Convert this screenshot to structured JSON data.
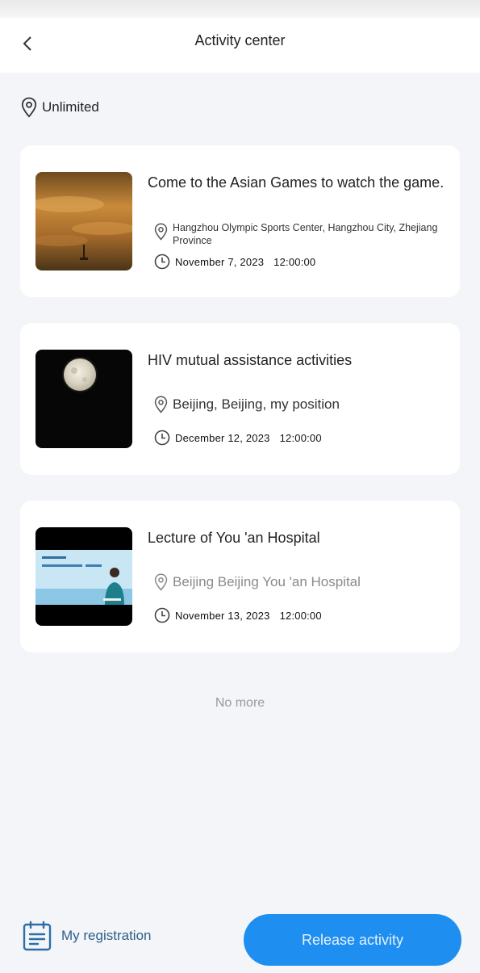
{
  "header": {
    "title": "Activity center"
  },
  "filter": {
    "label": "Unlimited"
  },
  "activities": [
    {
      "title": "Come to the Asian Games to watch the game.",
      "location": "Hangzhou Olympic Sports Center, Hangzhou City, Zhejiang Province",
      "date": "November 7, 2023",
      "time": "12:00:00"
    },
    {
      "title": "HIV mutual assistance activities",
      "location": "Beijing, Beijing, my position",
      "date": "December 12, 2023",
      "time": "12:00:00"
    },
    {
      "title": "Lecture of You 'an Hospital",
      "location": "Beijing Beijing You 'an Hospital",
      "date": "November 13, 2023",
      "time": "12:00:00"
    }
  ],
  "footer_note": "No more",
  "bottom_bar": {
    "my_registration": "My registration",
    "release": "Release activity"
  },
  "colors": {
    "accent": "#1e8ef0",
    "background": "#f3f5f9",
    "card": "#ffffff"
  },
  "icons": [
    "chevron-left-icon",
    "location-pin-icon",
    "clock-icon",
    "registration-list-icon"
  ]
}
